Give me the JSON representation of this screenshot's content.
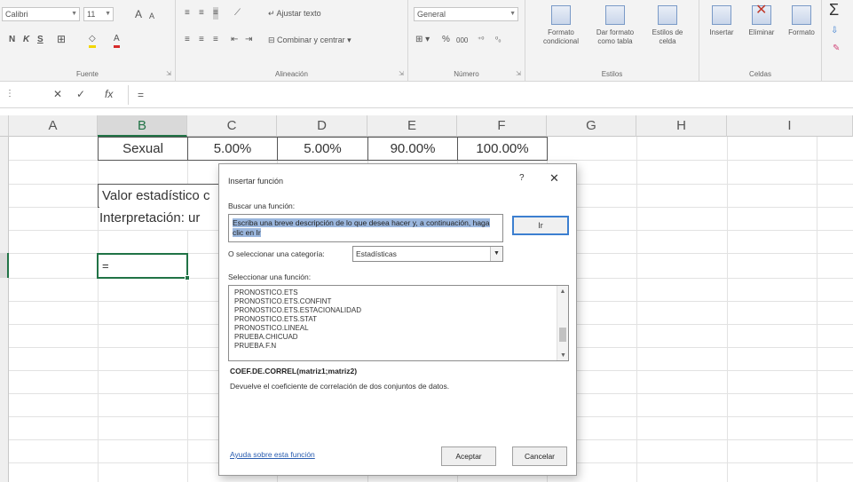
{
  "ribbon": {
    "font": {
      "name": "Calibri",
      "size": "11",
      "grow_label": "A",
      "shrink_label": "A",
      "bold": "N",
      "italic": "K",
      "underline": "S",
      "group_label": "Fuente"
    },
    "alignment": {
      "wrap_text": "Ajustar texto",
      "merge_center": "Combinar y centrar",
      "group_label": "Alineación"
    },
    "number": {
      "format": "General",
      "percent": "%",
      "thousands": "000",
      "group_label": "Número"
    },
    "styles": {
      "conditional_format": [
        "Formato",
        "condicional"
      ],
      "format_table": [
        "Dar formato",
        "como tabla"
      ],
      "cell_styles": [
        "Estilos de",
        "celda"
      ],
      "group_label": "Estilos"
    },
    "cells": {
      "insert": "Insertar",
      "delete": "Eliminar",
      "format": "Formato",
      "group_label": "Celdas"
    },
    "sigma": "Σ"
  },
  "formula_bar": {
    "cancel": "✕",
    "confirm": "✓",
    "fx": "fx",
    "content": "="
  },
  "sheet": {
    "columns": [
      "A",
      "B",
      "C",
      "D",
      "E",
      "F",
      "G",
      "H",
      "I"
    ],
    "selected_column": "B",
    "row_data": {
      "label": "Sexual",
      "values": [
        "5.00%",
        "5.00%",
        "90.00%",
        "100.00%"
      ]
    },
    "valor_text": "Valor estadístico c",
    "interp_text": "Interpretación: ur",
    "active_cell_text": "="
  },
  "dialog": {
    "title": "Insertar función",
    "help_char": "?",
    "close_char": "✕",
    "search_label": "Buscar una función:",
    "search_text": "Escriba una breve descripción de lo que desea hacer y, a continuación, haga clic en Ir",
    "go_button": "Ir",
    "category_label": "O seleccionar una categoría:",
    "category_value": "Estadísticas",
    "select_label": "Seleccionar una función:",
    "functions": [
      "PRONOSTICO.ETS",
      "PRONOSTICO.ETS.CONFINT",
      "PRONOSTICO.ETS.ESTACIONALIDAD",
      "PRONOSTICO.ETS.STAT",
      "PRONOSTICO.LINEAL",
      "PRUEBA.CHICUAD",
      "PRUEBA.F.N"
    ],
    "signature": "COEF.DE.CORREL(matriz1;matriz2)",
    "description": "Devuelve el coeficiente de correlación de dos conjuntos de datos.",
    "help_link": "Ayuda sobre esta función",
    "ok_button": "Aceptar",
    "cancel_button": "Cancelar"
  },
  "colors": {
    "accent_green": "#217346",
    "link_blue": "#2a5db0",
    "selection_blue": "#9bb7de"
  }
}
